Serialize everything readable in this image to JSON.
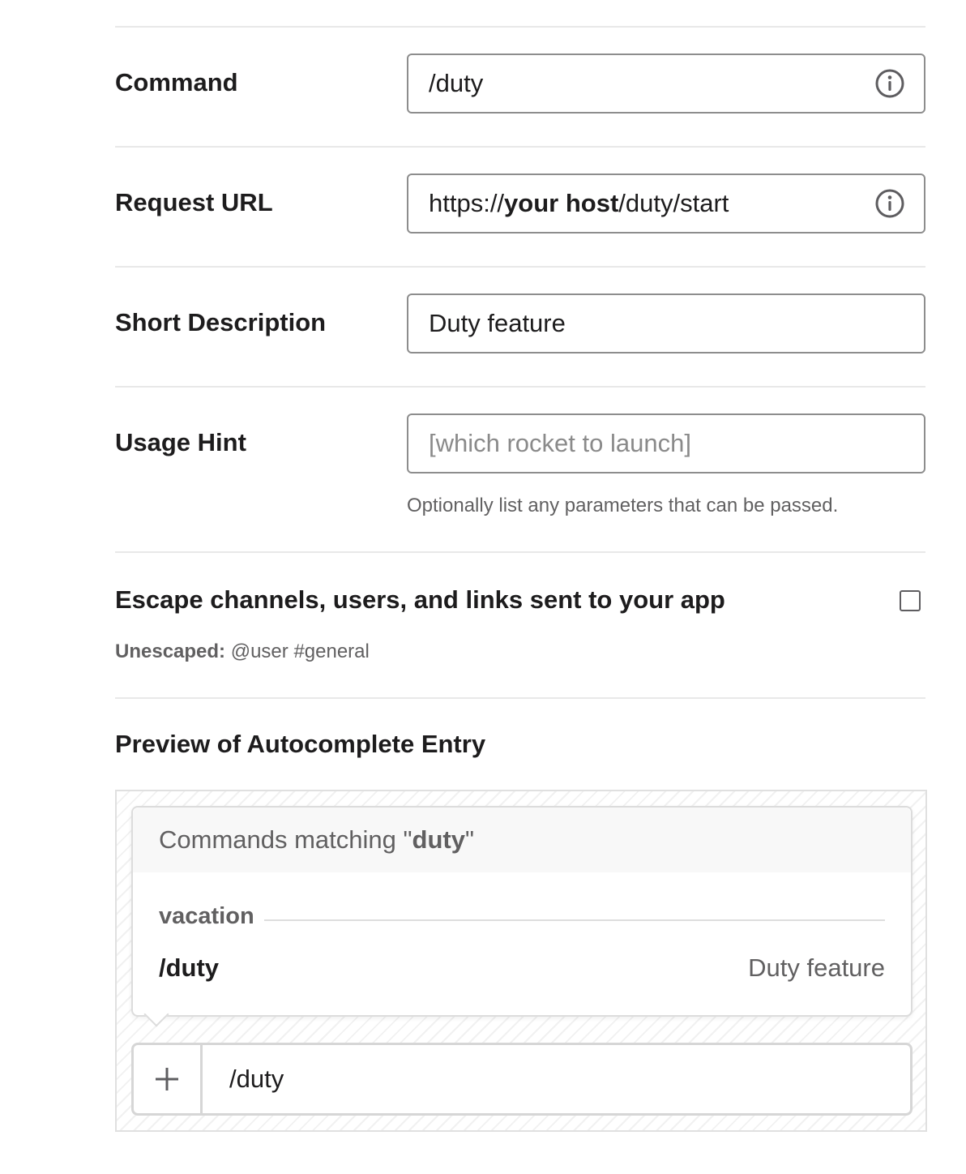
{
  "form": {
    "command": {
      "label": "Command",
      "value": "/duty"
    },
    "request_url": {
      "label": "Request URL",
      "prefix": "https://",
      "host": "your host",
      "suffix": "/duty/start"
    },
    "short_description": {
      "label": "Short Description",
      "value": "Duty feature"
    },
    "usage_hint": {
      "label": "Usage Hint",
      "placeholder": "[which rocket to launch]",
      "help": "Optionally list any parameters that can be passed."
    },
    "escape": {
      "label": "Escape channels, users, and links sent to your app",
      "checked": false,
      "unescaped_label": "Unescaped:",
      "unescaped_value": "@user #general"
    }
  },
  "preview": {
    "title": "Preview of Autocomplete Entry",
    "header_prefix": "Commands matching \"",
    "header_query": "duty",
    "header_suffix": "\"",
    "group": "vacation",
    "command": "/duty",
    "description": "Duty feature",
    "composer_value": "/duty"
  },
  "icons": [
    "info-icon",
    "checkbox-icon",
    "plus-icon"
  ],
  "colors": {
    "text": "#1d1c1d",
    "muted": "#616061",
    "border": "#8d8d8d",
    "divider": "#e8e8e8"
  }
}
